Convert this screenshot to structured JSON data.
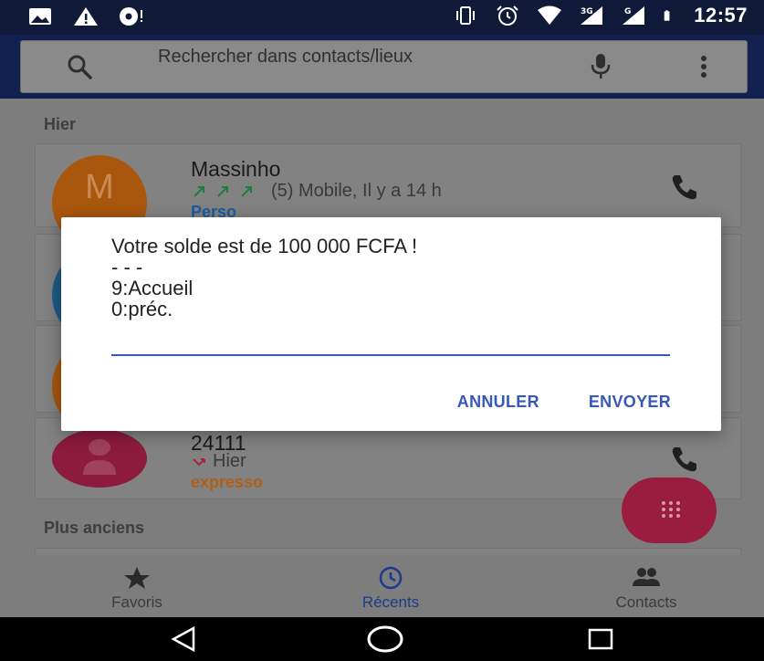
{
  "status_bar": {
    "time": "12:57",
    "icons": [
      "image-icon",
      "warning-icon",
      "circle-notification-icon",
      "vibrate-icon",
      "alarm-icon",
      "wifi-icon",
      "signal-3g-icon",
      "signal-icon",
      "battery-icon"
    ]
  },
  "search": {
    "placeholder": "Rechercher dans contacts/lieux"
  },
  "sections": {
    "yesterday": "Hier",
    "older": "Plus anciens"
  },
  "contacts": [
    {
      "initial": "M",
      "name": "Massinho",
      "meta": "(5) Mobile, Il y a 14 h",
      "tag": "Perso",
      "tag_color": "#1e5b9e",
      "avatar_color": "#a9560e"
    },
    {
      "name": "24111",
      "meta": "Hier",
      "tag": "expresso",
      "tag_color": "#b0601a",
      "avatar_color": "#8c1b3e"
    }
  ],
  "dialog": {
    "message": "Votre solde est de 100 000 FCFA !\n- - -\n9:Accueil\n0:préc.",
    "input_value": "",
    "cancel_label": "ANNULER",
    "send_label": "ENVOYER"
  },
  "bottom_nav": {
    "favorites": "Favoris",
    "recents": "Récents",
    "contacts": "Contacts"
  },
  "colors": {
    "accent": "#3658b8",
    "fab": "#9a1d41",
    "status_bar": "#0e1a38"
  }
}
